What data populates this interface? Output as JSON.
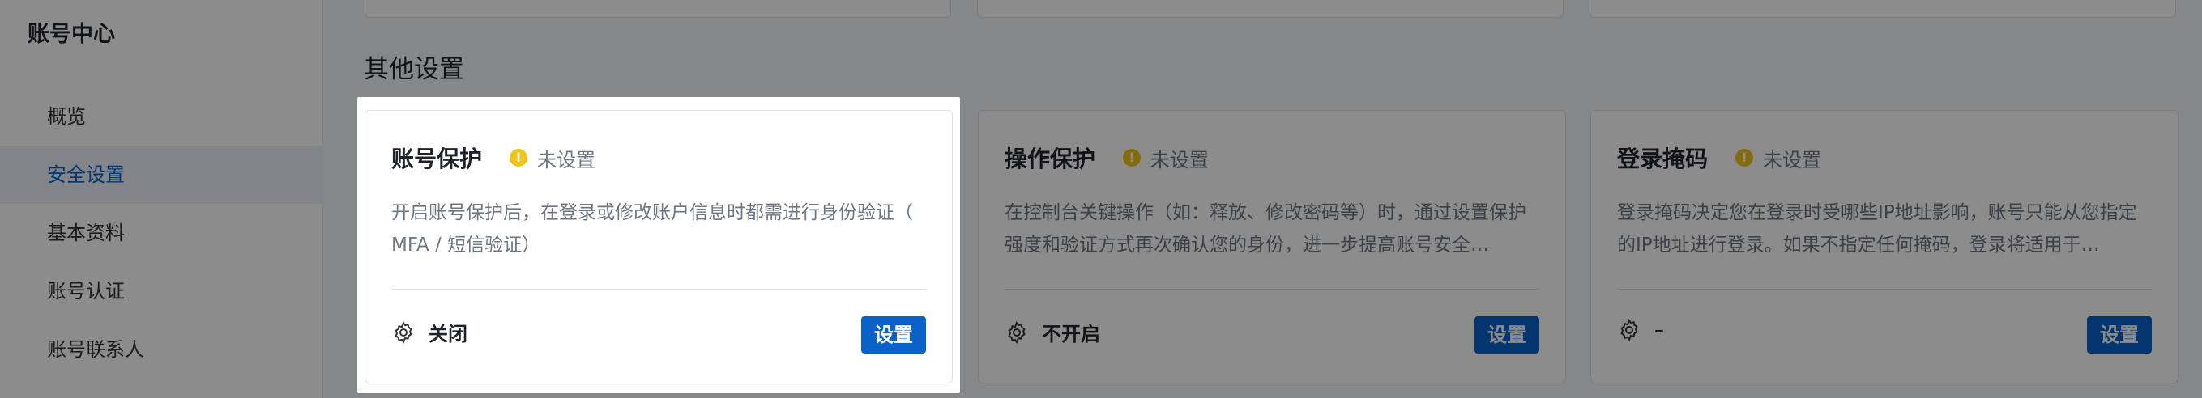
{
  "sidebar": {
    "title": "账号中心",
    "items": [
      {
        "label": "概览"
      },
      {
        "label": "安全设置",
        "active": true
      },
      {
        "label": "基本资料"
      },
      {
        "label": "账号认证"
      },
      {
        "label": "账号联系人"
      }
    ]
  },
  "main": {
    "section_title": "其他设置",
    "cards": [
      {
        "title": "账号保护",
        "status": "未设置",
        "description": "开启账号保护后，在登录或修改账户信息时都需进行身份验证（ MFA / 短信验证）",
        "footer_label": "关闭",
        "button": "设置"
      },
      {
        "title": "操作保护",
        "status": "未设置",
        "description": "在控制台关键操作（如：释放、修改密码等）时，通过设置保护强度和验证方式再次确认您的身份，进一步提高账号安全…",
        "footer_label": "不开启",
        "button": "设置"
      },
      {
        "title": "登录掩码",
        "status": "未设置",
        "description": "登录掩码决定您在登录时受哪些IP地址影响，账号只能从您指定的IP地址进行登录。如果不指定任何掩码，登录将适用于…",
        "footer_label": "–",
        "button": "设置"
      }
    ]
  },
  "colors": {
    "accent": "#0a62c9",
    "warning": "#f0c419"
  },
  "icons": {
    "status": "warning-icon",
    "footer": "gear-icon"
  }
}
